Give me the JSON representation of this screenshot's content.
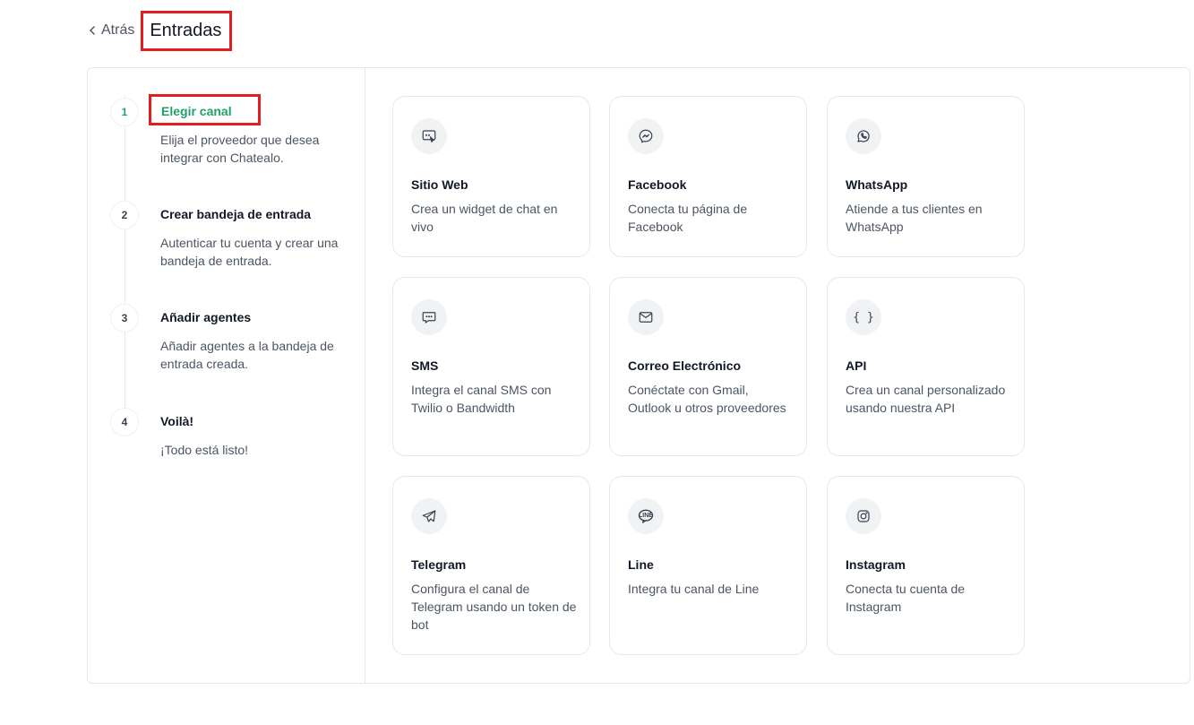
{
  "header": {
    "back_label": "Atrás",
    "title": "Entradas"
  },
  "steps": [
    {
      "number": "1",
      "title": "Elegir canal",
      "description": "Elija el proveedor que desea integrar con Chatealo."
    },
    {
      "number": "2",
      "title": "Crear bandeja de entrada",
      "description": "Autenticar tu cuenta y crear una bandeja de entrada."
    },
    {
      "number": "3",
      "title": "Añadir agentes",
      "description": "Añadir agentes a la bandeja de entrada creada."
    },
    {
      "number": "4",
      "title": "Voilà!",
      "description": "¡Todo está listo!"
    }
  ],
  "channels": [
    {
      "title": "Sitio Web",
      "description": "Crea un widget de chat en vivo",
      "icon": "website-chat-icon"
    },
    {
      "title": "Facebook",
      "description": "Conecta tu página de Facebook",
      "icon": "messenger-icon"
    },
    {
      "title": "WhatsApp",
      "description": "Atiende a tus clientes en WhatsApp",
      "icon": "whatsapp-icon"
    },
    {
      "title": "SMS",
      "description": "Integra el canal SMS con Twilio o Bandwidth",
      "icon": "sms-icon"
    },
    {
      "title": "Correo Electrónico",
      "description": "Conéctate con Gmail, Outlook u otros proveedores",
      "icon": "mail-icon"
    },
    {
      "title": "API",
      "description": "Crea un canal personalizado usando nuestra API",
      "icon": "braces-icon",
      "icon_text": "{ }"
    },
    {
      "title": "Telegram",
      "description": "Configura el canal de Telegram usando un token de bot",
      "icon": "telegram-icon"
    },
    {
      "title": "Line",
      "description": "Integra tu canal de Line",
      "icon": "line-icon",
      "icon_text": "LINE"
    },
    {
      "title": "Instagram",
      "description": "Conecta tu cuenta de Instagram",
      "icon": "instagram-icon"
    }
  ],
  "colors": {
    "active_step": "#22a06b",
    "highlight_box": "#e11d1d",
    "border": "#e5e7eb"
  }
}
